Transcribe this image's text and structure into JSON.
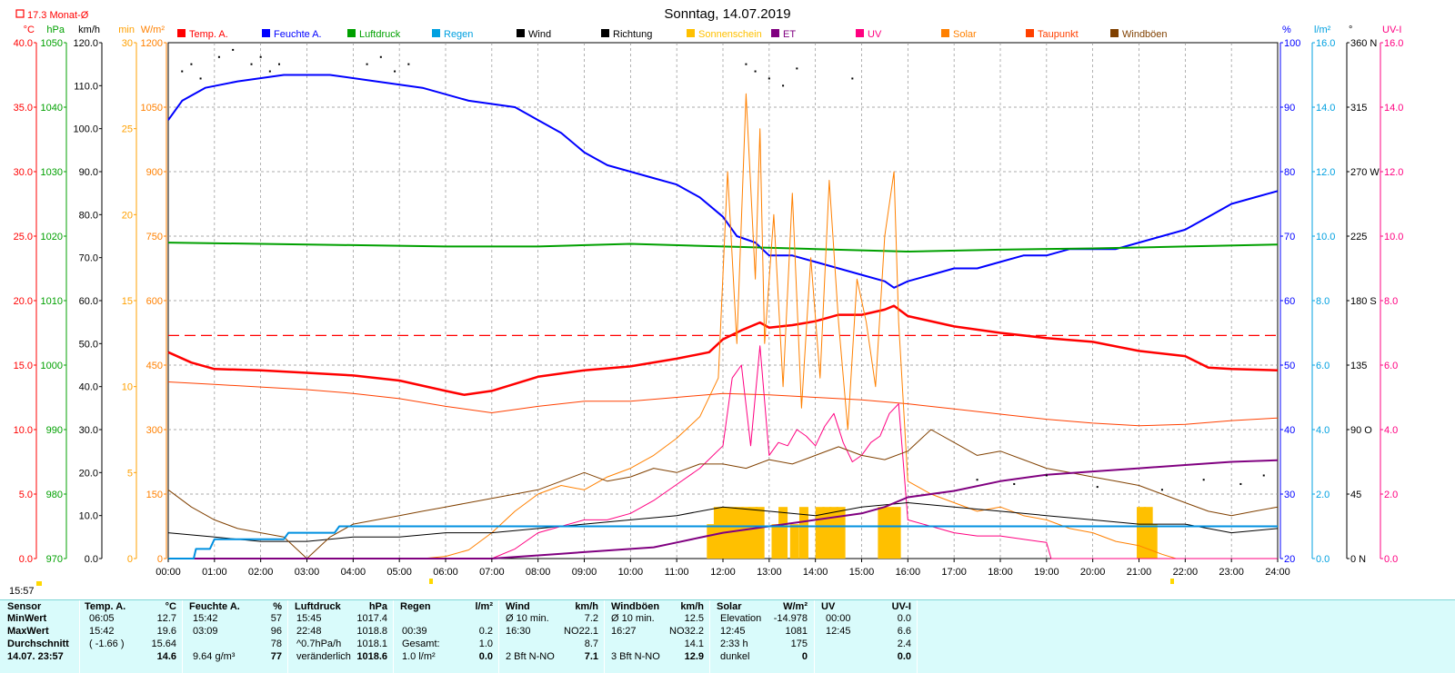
{
  "title": "Sonntag, 14.07.2019",
  "month_avg_label": "17.3 Monat-Ø",
  "current_time": "15:57",
  "legend": [
    {
      "label": "Temp. A.",
      "color": "#ff0000"
    },
    {
      "label": "Feuchte A.",
      "color": "#0000ff"
    },
    {
      "label": "Luftdruck",
      "color": "#00a000"
    },
    {
      "label": "Regen",
      "color": "#00a0e0"
    },
    {
      "label": "Wind",
      "color": "#000000"
    },
    {
      "label": "Richtung",
      "color": "#000000"
    },
    {
      "label": "Sonnenschein",
      "color": "#ffc000"
    },
    {
      "label": "ET",
      "color": "#800080"
    },
    {
      "label": "UV",
      "color": "#ff0080"
    },
    {
      "label": "Solar",
      "color": "#ff8000"
    },
    {
      "label": "Taupunkt",
      "color": "#ff4000"
    },
    {
      "label": "Windböen",
      "color": "#804000"
    }
  ],
  "chart_data": {
    "type": "line",
    "title": "Sonntag, 14.07.2019",
    "x_ticks": [
      "00:00",
      "01:00",
      "02:00",
      "03:00",
      "04:00",
      "05:00",
      "06:00",
      "07:00",
      "08:00",
      "09:00",
      "10:00",
      "11:00",
      "12:00",
      "13:00",
      "14:00",
      "15:00",
      "16:00",
      "17:00",
      "18:00",
      "19:00",
      "20:00",
      "21:00",
      "22:00",
      "23:00",
      "24:00"
    ],
    "axes": {
      "temp": {
        "unit": "°C",
        "color": "#ff0000",
        "range": [
          0,
          40
        ],
        "ticks": [
          "0.0",
          "5.0",
          "10.0",
          "15.0",
          "20.0",
          "25.0",
          "30.0",
          "35.0",
          "40.0"
        ]
      },
      "pressure": {
        "unit": "hPa",
        "color": "#00a000",
        "range": [
          970,
          1050
        ],
        "ticks": [
          "970",
          "980",
          "990",
          "1000",
          "1010",
          "1020",
          "1030",
          "1040",
          "1050"
        ]
      },
      "wind": {
        "unit": "km/h",
        "color": "#000000",
        "range": [
          0,
          120
        ],
        "ticks": [
          "0.0",
          "10.0",
          "20.0",
          "30.0",
          "40.0",
          "50.0",
          "60.0",
          "70.0",
          "80.0",
          "90.0",
          "100.0",
          "110.0",
          "120.0"
        ]
      },
      "sunmin": {
        "unit": "min",
        "color": "#ffa000",
        "range": [
          0,
          30
        ],
        "ticks": [
          "0",
          "5",
          "10",
          "15",
          "20",
          "25",
          "30"
        ]
      },
      "solar": {
        "unit": "W/m²",
        "color": "#ff8000",
        "range": [
          0,
          1200
        ],
        "ticks": [
          "0",
          "150",
          "300",
          "450",
          "600",
          "750",
          "900",
          "1050",
          "1200"
        ]
      },
      "humidity": {
        "unit": "%",
        "color": "#0000ff",
        "range": [
          20,
          100
        ],
        "ticks": [
          "20",
          "30",
          "40",
          "50",
          "60",
          "70",
          "80",
          "90",
          "100"
        ]
      },
      "rain": {
        "unit": "l/m²",
        "color": "#00a0e0",
        "range": [
          0,
          16
        ],
        "ticks": [
          "0.0",
          "2.0",
          "4.0",
          "6.0",
          "8.0",
          "10.0",
          "12.0",
          "14.0",
          "16.0"
        ]
      },
      "direction": {
        "unit": "°",
        "color": "#000000",
        "range": [
          0,
          360
        ],
        "ticks": [
          "0 N",
          "45",
          "90 O",
          "135",
          "180 S",
          "225",
          "270 W",
          "315",
          "360 N"
        ]
      },
      "uv": {
        "unit": "UV-I",
        "color": "#ff0080",
        "range": [
          0,
          16
        ],
        "ticks": [
          "0.0",
          "2.0",
          "4.0",
          "6.0",
          "8.0",
          "10.0",
          "12.0",
          "14.0",
          "16.0"
        ]
      }
    },
    "month_avg_temp": 17.3,
    "series": [
      {
        "name": "Temp. A.",
        "axis": "temp",
        "color": "#ff0000",
        "width": 2.5,
        "x": [
          0,
          0.5,
          1,
          2,
          3,
          4,
          5,
          6,
          6.4,
          7,
          8,
          9,
          10,
          11,
          11.7,
          12,
          12.4,
          12.8,
          13,
          13.5,
          14,
          14.5,
          15,
          15.5,
          15.7,
          16,
          17,
          18,
          19,
          20,
          21,
          22,
          22.5,
          23,
          24
        ],
        "y": [
          16.0,
          15.2,
          14.7,
          14.6,
          14.4,
          14.2,
          13.8,
          13.0,
          12.7,
          13.0,
          14.1,
          14.6,
          14.9,
          15.5,
          16.0,
          17.0,
          17.7,
          18.3,
          17.9,
          18.1,
          18.4,
          18.9,
          18.9,
          19.3,
          19.6,
          18.8,
          18.0,
          17.5,
          17.1,
          16.8,
          16.1,
          15.7,
          14.8,
          14.7,
          14.6
        ]
      },
      {
        "name": "Feuchte A.",
        "axis": "humidity",
        "color": "#0000ff",
        "width": 2,
        "x": [
          0,
          0.3,
          0.8,
          1.5,
          2.5,
          3.5,
          4.5,
          5.5,
          6.5,
          7.5,
          8,
          8.5,
          9,
          9.5,
          10,
          10.5,
          11,
          11.5,
          12,
          12.3,
          12.7,
          13,
          13.5,
          14,
          14.5,
          15,
          15.5,
          15.7,
          16,
          16.5,
          17,
          17.5,
          18,
          18.5,
          19,
          19.5,
          20,
          20.5,
          21,
          21.5,
          22,
          22.5,
          23,
          23.5,
          24
        ],
        "y": [
          88,
          91,
          93,
          94,
          95,
          95,
          94,
          93,
          91,
          90,
          88,
          86,
          83,
          81,
          80,
          79,
          78,
          76,
          73,
          70,
          69,
          67,
          67,
          66,
          65,
          64,
          63,
          62,
          63,
          64,
          65,
          65,
          66,
          67,
          67,
          68,
          68,
          68,
          69,
          70,
          71,
          73,
          75,
          76,
          77
        ]
      },
      {
        "name": "Luftdruck",
        "axis": "pressure",
        "color": "#00a000",
        "width": 2,
        "x": [
          0,
          2,
          4,
          6,
          8,
          10,
          12,
          14,
          16,
          18,
          20,
          22,
          24
        ],
        "y": [
          1019.0,
          1018.8,
          1018.6,
          1018.4,
          1018.4,
          1018.8,
          1018.4,
          1018.0,
          1017.6,
          1017.9,
          1018.1,
          1018.4,
          1018.7
        ]
      },
      {
        "name": "Taupunkt",
        "axis": "temp",
        "color": "#ff4000",
        "width": 1,
        "x": [
          0,
          1,
          2,
          3,
          4,
          5,
          6,
          7,
          8,
          9,
          10,
          11,
          12,
          13,
          14,
          15,
          16,
          17,
          18,
          19,
          20,
          21,
          22,
          23,
          24
        ],
        "y": [
          13.7,
          13.5,
          13.3,
          13.1,
          12.8,
          12.4,
          11.8,
          11.3,
          11.8,
          12.2,
          12.2,
          12.5,
          12.8,
          12.7,
          12.5,
          12.3,
          12.0,
          11.6,
          11.2,
          10.8,
          10.5,
          10.3,
          10.4,
          10.7,
          10.9
        ]
      },
      {
        "name": "Solar",
        "axis": "solar",
        "color": "#ff8000",
        "width": 1,
        "x": [
          0,
          5.5,
          6,
          6.5,
          7,
          7.5,
          8,
          8.5,
          9,
          9.5,
          10,
          10.5,
          11,
          11.5,
          11.9,
          12.1,
          12.3,
          12.5,
          12.7,
          12.8,
          12.9,
          13.1,
          13.3,
          13.5,
          13.7,
          13.9,
          14.1,
          14.3,
          14.5,
          14.7,
          14.9,
          15.1,
          15.3,
          15.5,
          15.7,
          15.8,
          16,
          16.5,
          17,
          17.5,
          18,
          18.5,
          19,
          19.5,
          20,
          20.5,
          21,
          21.5,
          21.8,
          24
        ],
        "y": [
          0,
          0,
          5,
          20,
          60,
          110,
          150,
          170,
          160,
          190,
          210,
          240,
          280,
          330,
          420,
          900,
          500,
          1081,
          650,
          1000,
          500,
          800,
          400,
          850,
          350,
          700,
          420,
          880,
          550,
          300,
          650,
          550,
          400,
          750,
          900,
          550,
          180,
          150,
          130,
          110,
          120,
          100,
          90,
          70,
          60,
          40,
          30,
          10,
          0,
          0
        ]
      },
      {
        "name": "UV",
        "axis": "uv",
        "color": "#ff0080",
        "width": 1,
        "x": [
          0,
          7,
          7.5,
          8,
          8.5,
          9,
          9.5,
          10,
          10.5,
          11,
          11.5,
          12,
          12.2,
          12.4,
          12.6,
          12.8,
          13,
          13.2,
          13.4,
          13.6,
          13.8,
          14,
          14.2,
          14.4,
          14.6,
          14.8,
          15,
          15.2,
          15.4,
          15.6,
          15.8,
          16,
          16.5,
          17,
          17.5,
          18,
          18.5,
          19,
          19.1,
          24
        ],
        "y": [
          0,
          0,
          0.3,
          0.8,
          1.0,
          1.2,
          1.2,
          1.4,
          1.8,
          2.3,
          2.8,
          3.5,
          5.6,
          6.0,
          3.5,
          6.6,
          3.2,
          3.6,
          3.5,
          4.0,
          3.8,
          3.5,
          4.1,
          4.5,
          3.6,
          3.0,
          3.2,
          3.6,
          3.8,
          4.5,
          4.8,
          1.2,
          1.0,
          0.8,
          0.7,
          0.7,
          0.6,
          0.5,
          0,
          0
        ]
      },
      {
        "name": "Wind",
        "axis": "wind",
        "color": "#000000",
        "width": 1,
        "x": [
          0,
          1,
          2,
          3,
          4,
          5,
          6,
          7,
          8,
          9,
          10,
          11,
          12,
          13,
          14,
          15,
          16,
          17,
          18,
          19,
          20,
          21,
          22,
          23,
          24
        ],
        "y": [
          6,
          5,
          4,
          4,
          5,
          5,
          6,
          6,
          7,
          8,
          9,
          10,
          12,
          11,
          10,
          12,
          13,
          12,
          11,
          10,
          9,
          8,
          8,
          6,
          7
        ]
      },
      {
        "name": "Windböen",
        "axis": "wind",
        "color": "#804000",
        "width": 1,
        "x": [
          0,
          0.5,
          1,
          1.5,
          2,
          2.5,
          3,
          3.5,
          4,
          4.5,
          5,
          5.5,
          6,
          6.5,
          7,
          7.5,
          8,
          8.5,
          9,
          9.5,
          10,
          10.5,
          11,
          11.5,
          12,
          12.5,
          13,
          13.5,
          14,
          14.5,
          15,
          15.5,
          16,
          16.5,
          17,
          17.5,
          18,
          18.5,
          19,
          19.5,
          20,
          20.5,
          21,
          21.5,
          22,
          22.5,
          23,
          23.5,
          24
        ],
        "y": [
          16,
          12,
          9,
          7,
          6,
          5,
          0,
          5,
          8,
          9,
          10,
          11,
          12,
          13,
          14,
          15,
          16,
          18,
          20,
          18,
          19,
          21,
          20,
          22,
          22,
          21,
          23,
          22,
          24,
          26,
          24,
          23,
          25,
          30,
          27,
          24,
          25,
          23,
          21,
          20,
          19,
          18,
          17,
          15,
          13,
          11,
          10,
          11,
          12
        ]
      },
      {
        "name": "ET",
        "axis": "rain",
        "color": "#800080",
        "width": 2,
        "x": [
          0,
          7,
          7.5,
          8.5,
          9.5,
          10.5,
          11,
          11.5,
          12,
          13,
          14,
          15,
          15.5,
          16,
          17,
          18,
          19,
          20,
          21,
          22,
          23,
          24
        ],
        "y": [
          0,
          0,
          0.05,
          0.15,
          0.25,
          0.35,
          0.5,
          0.65,
          0.8,
          1.0,
          1.2,
          1.4,
          1.6,
          1.9,
          2.1,
          2.4,
          2.6,
          2.7,
          2.8,
          2.9,
          3.0,
          3.05
        ]
      },
      {
        "name": "Regen",
        "axis": "rain",
        "color": "#0090e0",
        "width": 2,
        "x": [
          0,
          0.55,
          0.6,
          0.9,
          1.0,
          2.5,
          2.6,
          3.6,
          3.7,
          24
        ],
        "y": [
          0,
          0,
          0.3,
          0.3,
          0.6,
          0.6,
          0.8,
          0.8,
          1.0,
          1.0
        ]
      }
    ],
    "sunshine_bars": {
      "axis": "sunmin",
      "color": "#ffc000",
      "x": [
        11.75,
        11.9,
        12.05,
        12.2,
        12.35,
        12.5,
        12.65,
        12.8,
        13.15,
        13.3,
        13.55,
        13.75,
        14.1,
        14.25,
        14.4,
        14.55,
        15.45,
        15.6,
        15.75,
        21.05,
        21.2,
        21.3
      ],
      "y": [
        2,
        3,
        3,
        3,
        3,
        3,
        3,
        3,
        2,
        3,
        2,
        3,
        3,
        3,
        3,
        3,
        3,
        3,
        3,
        3,
        3,
        2
      ]
    },
    "direction_points": {
      "axis": "direction",
      "x": [
        0.3,
        0.5,
        0.7,
        1.1,
        1.4,
        1.8,
        2.0,
        2.2,
        2.4,
        4.3,
        4.6,
        4.9,
        5.2,
        12.5,
        12.7,
        13.0,
        13.3,
        13.6,
        14.8,
        17.5,
        18.3,
        19.0,
        20.1,
        21.5,
        22.4,
        23.2,
        23.7
      ],
      "y": [
        340,
        345,
        335,
        350,
        355,
        345,
        350,
        340,
        345,
        345,
        350,
        340,
        345,
        345,
        340,
        335,
        330,
        342,
        335,
        55,
        52,
        58,
        50,
        48,
        55,
        52,
        58
      ]
    }
  },
  "stats": {
    "headers": {
      "sensor": "Sensor",
      "temp": "Temp. A.",
      "temp_unit": "°C",
      "hum": "Feuchte A.",
      "hum_unit": "%",
      "press": "Luftdruck",
      "press_unit": "hPa",
      "rain": "Regen",
      "rain_unit": "l/m²",
      "wind": "Wind",
      "wind_unit": "km/h",
      "gust": "Windböen",
      "gust_unit": "km/h",
      "solar": "Solar",
      "solar_unit": "W/m²",
      "uv": "UV",
      "uv_unit": "UV-I"
    },
    "rows": [
      {
        "label": "MinWert",
        "temp_t": "06:05",
        "temp_v": "12.7",
        "hum_t": "15:42",
        "hum_v": "57",
        "press_t": "15:45",
        "press_v": "1017.4",
        "rain_t": "",
        "rain_v": "",
        "wind_t": "Ø 10 min.",
        "wind_d": "",
        "wind_v": "7.2",
        "gust_t": "Ø 10 min.",
        "gust_d": "",
        "gust_v": "12.5",
        "solar_t": "Elevation",
        "solar_v": "-14.978",
        "uv_t": "00:00",
        "uv_v": "0.0"
      },
      {
        "label": "MaxWert",
        "temp_t": "15:42",
        "temp_v": "19.6",
        "hum_t": "03:09",
        "hum_v": "96",
        "press_t": "22:48",
        "press_v": "1018.8",
        "rain_t": "00:39",
        "rain_v": "0.2",
        "wind_t": "16:30",
        "wind_d": "NO",
        "wind_v": "22.1",
        "gust_t": "16:27",
        "gust_d": "NO",
        "gust_v": "32.2",
        "solar_t": "12:45",
        "solar_v": "1081",
        "uv_t": "12:45",
        "uv_v": "6.6"
      },
      {
        "label": "Durchschnitt",
        "temp_t": "( -1.66 )",
        "temp_v": "15.64",
        "hum_t": "",
        "hum_v": "78",
        "press_t": "^0.7hPa/h",
        "press_v": "1018.1",
        "rain_t": "Gesamt:",
        "rain_v": "1.0",
        "wind_t": "",
        "wind_d": "",
        "wind_v": "8.7",
        "gust_t": "",
        "gust_d": "",
        "gust_v": "14.1",
        "solar_t": "2:33 h",
        "solar_v": "175",
        "uv_t": "",
        "uv_v": "2.4"
      },
      {
        "label": "14.07. 23:57",
        "temp_t": "",
        "temp_v": "14.6",
        "hum_t": "9.64 g/m³",
        "hum_v": "77",
        "press_t": "veränderlich",
        "press_v": "1018.6",
        "rain_t": "1.0 l/m²",
        "rain_v": "0.0",
        "wind_t": "2 Bft N-NO",
        "wind_d": "",
        "wind_v": "7.1",
        "gust_t": "3 Bft N-NO",
        "gust_d": "",
        "gust_v": "12.9",
        "solar_t": "dunkel",
        "solar_v": "0",
        "uv_t": "",
        "uv_v": "0.0"
      }
    ]
  }
}
